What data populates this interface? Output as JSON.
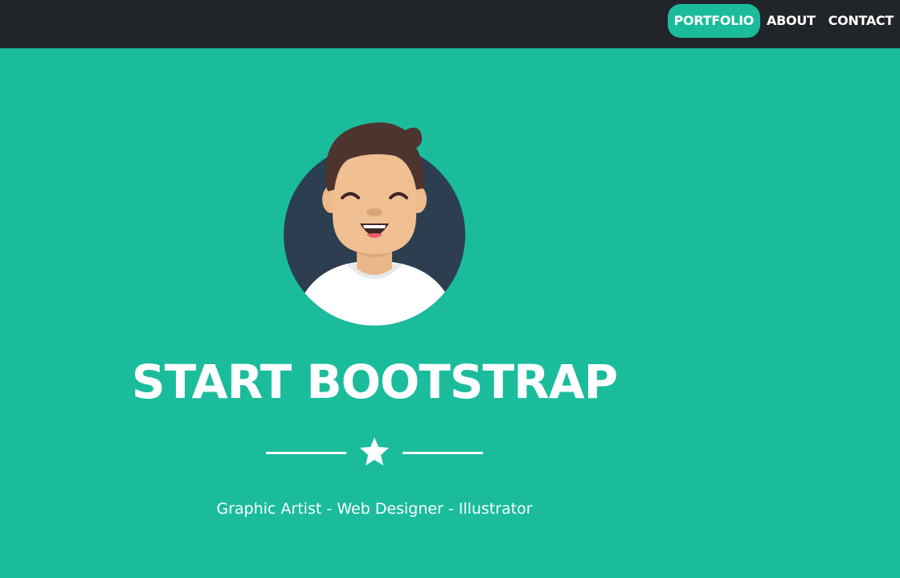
{
  "nav": {
    "items": [
      {
        "label": "PORTFOLIO",
        "active": true
      },
      {
        "label": "ABOUT",
        "active": false
      },
      {
        "label": "CONTACT",
        "active": false
      }
    ]
  },
  "masthead": {
    "title": "START BOOTSTRAP",
    "subtitle": "Graphic Artist - Web Designer - Illustrator",
    "avatar_icon": "avatar-illustration",
    "divider_icon": "star-icon"
  },
  "colors": {
    "navbar_bg": "#212529",
    "masthead_bg": "#1abc9c",
    "active_nav_bg": "#1abc9c",
    "text": "#ffffff",
    "avatar_circle": "#2c3e50"
  }
}
